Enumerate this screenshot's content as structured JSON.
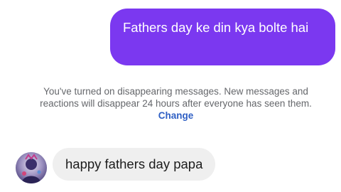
{
  "conversation": {
    "sent_message": "Fathers day ke din kya bolte hai",
    "notice": {
      "text": "You've turned on disappearing messages. New messages and reactions will disappear 24 hours after everyone has seen them.",
      "link_label": "Change"
    },
    "received_message": "happy fathers day papa",
    "avatar_icon": "contact-avatar-icon"
  },
  "colors": {
    "sent_bubble": "#7b38f0",
    "received_bubble": "#efefef",
    "link": "#2f5fc4",
    "notice_text": "#65676b"
  }
}
